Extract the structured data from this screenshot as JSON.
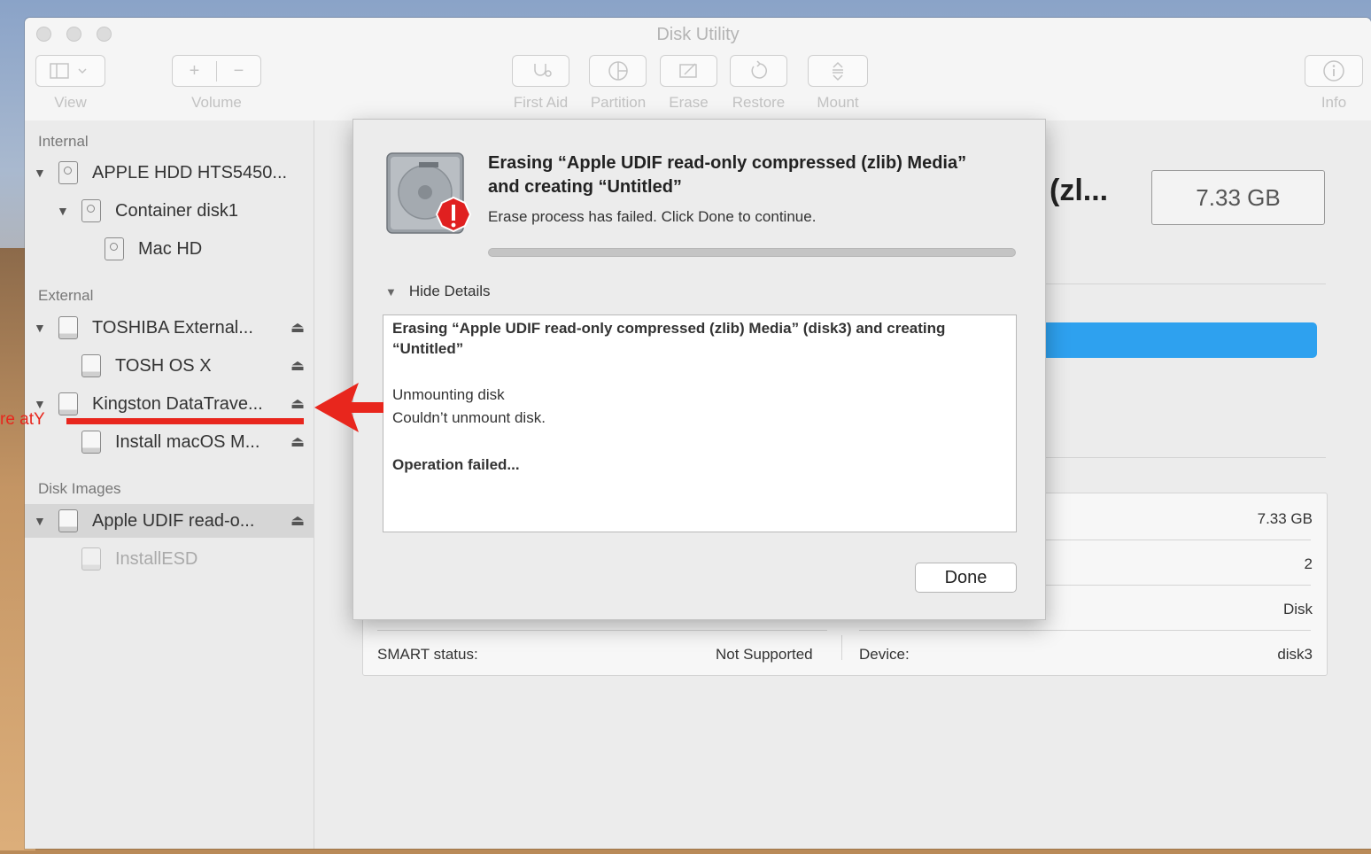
{
  "window": {
    "title": "Disk Utility",
    "toolbar": [
      {
        "name": "view",
        "label": "View"
      },
      {
        "name": "volume",
        "label": "Volume"
      },
      {
        "name": "first-aid",
        "label": "First Aid"
      },
      {
        "name": "partition",
        "label": "Partition"
      },
      {
        "name": "erase",
        "label": "Erase"
      },
      {
        "name": "restore",
        "label": "Restore"
      },
      {
        "name": "mount",
        "label": "Mount"
      },
      {
        "name": "info",
        "label": "Info"
      }
    ]
  },
  "sidebar": {
    "sections": {
      "internal": "Internal",
      "external": "External",
      "disk_images": "Disk Images"
    },
    "items": [
      {
        "label": "APPLE HDD HTS5450...",
        "icon": "internal-disk-icon"
      },
      {
        "label": "Container disk1",
        "icon": "internal-disk-icon"
      },
      {
        "label": "Mac HD",
        "icon": "internal-disk-icon"
      },
      {
        "label": "TOSHIBA External...",
        "icon": "external-disk-icon"
      },
      {
        "label": "TOSH OS X",
        "icon": "external-disk-icon"
      },
      {
        "label": "Kingston DataTrave...",
        "icon": "external-disk-icon"
      },
      {
        "label": "Install macOS M...",
        "icon": "external-disk-icon"
      },
      {
        "label": "Apple UDIF read-o...",
        "icon": "external-disk-icon"
      },
      {
        "label": "InstallESD",
        "icon": "external-disk-icon"
      }
    ]
  },
  "main": {
    "title_fragment": "(zl...",
    "capacity": "7.33 GB",
    "usage_fraction": 1.0,
    "info_rows": [
      {
        "right_value": "7.33 GB"
      },
      {
        "right_value": "2"
      },
      {
        "right_value": "Disk"
      }
    ],
    "smart_label": "SMART status:",
    "smart_value": "Not Supported",
    "device_label": "Device:",
    "device_value": "disk3"
  },
  "dialog": {
    "title": "Erasing “Apple UDIF read-only compressed (zlib) Media” and creating “Untitled”",
    "message": "Erase process has failed. Click Done to continue.",
    "toggle_label": "Hide Details",
    "details": {
      "line1": "Erasing “Apple UDIF read-only compressed (zlib) Media” (disk3) and creating “Untitled”",
      "line2": "Unmounting disk",
      "line3": "Couldn’t unmount disk.",
      "line4": "Operation failed..."
    },
    "done_label": "Done",
    "status_color": "#e02020"
  },
  "annotation": {
    "text": "re atY",
    "color": "#e8261d"
  }
}
